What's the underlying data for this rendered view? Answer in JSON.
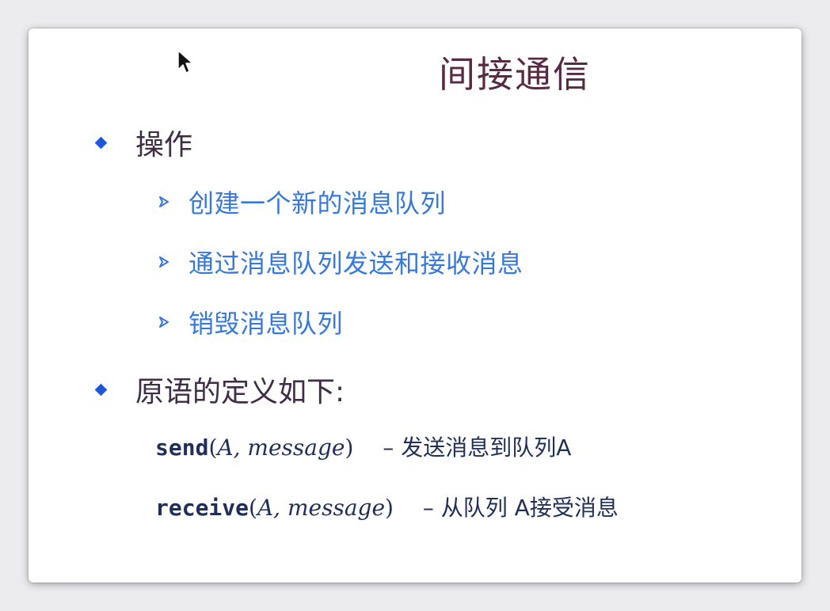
{
  "slide": {
    "title": "间接通信",
    "sections": [
      {
        "heading": "操作",
        "items": [
          "创建一个新的消息队列",
          "通过消息队列发送和接收消息",
          "销毁消息队列"
        ]
      },
      {
        "heading": "原语的定义如下:"
      }
    ],
    "primitives": [
      {
        "fn": "send",
        "open": "(",
        "arg1": "A,",
        "arg2": "message",
        "close": ")",
        "desc": "– 发送消息到队列A"
      },
      {
        "fn": "receive",
        "open": "(",
        "arg1": "A,",
        "arg2": "message",
        "close": ")",
        "desc": "– 从队列 A接受消息"
      }
    ]
  },
  "colors": {
    "title": "#5a2a45",
    "bullet_diamond": "#1d56d8",
    "level1_text": "#3f2c46",
    "level2_text": "#3779d8",
    "code_text": "#1f2f56"
  },
  "icons": {
    "cursor": "mouse-pointer-icon",
    "level1_bullet": "diamond-bullet-icon",
    "level2_bullet": "arrow-bullet-icon"
  }
}
